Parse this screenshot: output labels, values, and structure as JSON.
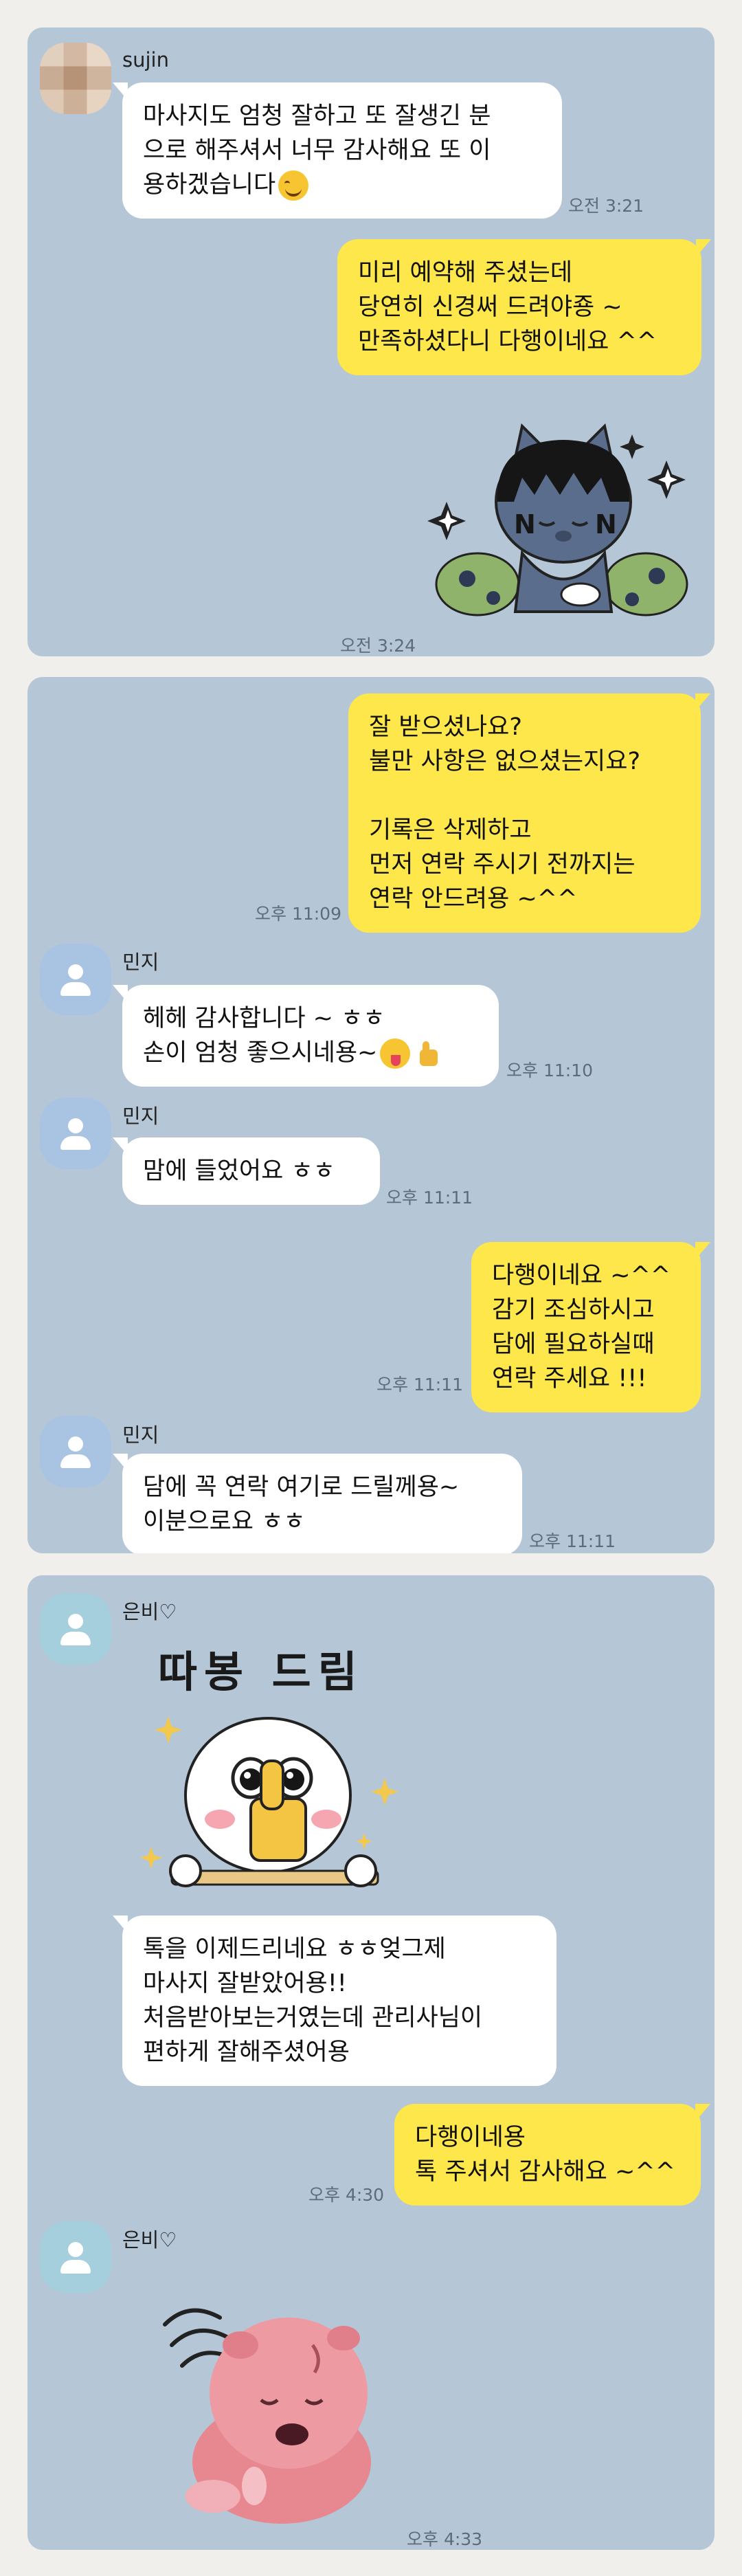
{
  "chat": [
    {
      "panel": "kakao-chat-screenshot-1",
      "sender": "sujin",
      "incoming_message": "마사지도 엄청 잘하고 또 잘생긴 분\n으로 해주셔서 너무 감사해요 또 이\n용하겠습니다",
      "incoming_time": "오전 3:21",
      "reply_message": "미리 예약해 주셨는데\n당연히 신경써 드려야죵 ~\n만족하셨다니 다행이네요 ^^",
      "sticker_time": "오전 3:24"
    },
    {
      "panel": "kakao-chat-screenshot-2",
      "out_message_1": "잘 받으셨나요?\n불만 사항은 없으셨는지요?\n\n기록은 삭제하고\n먼저 연락 주시기 전까지는\n연락 안드려용 ~^^",
      "out_time_1": "오후 11:09",
      "sender": "민지",
      "in_message_1": "헤헤 감사합니다 ~ ㅎㅎ\n손이 엄청 좋으시네용~",
      "in_time_1": "오후 11:10",
      "in_message_2": "맘에 들었어요 ㅎㅎ",
      "in_time_2": "오후 11:11",
      "out_message_2": "다행이네요 ~^^\n감기 조심하시고\n담에 필요하실때\n연락 주세요 !!!",
      "out_time_2": "오후 11:11",
      "in_message_3": "담에 꼭 연락 여기로 드릴께용~\n이분으로요 ㅎㅎ",
      "in_time_3": "오후 11:11"
    },
    {
      "panel": "kakao-chat-screenshot-3",
      "sender": "은비♡",
      "sticker_caption": "따봉 드림",
      "in_message": "톡을 이제드리네요 ㅎㅎ엊그제\n마사지 잘받았어용!!\n처음받아보는거였는데 관리사님이\n편하게 잘해주셨어용",
      "out_message": "다행이네용\n톡 주셔서 감사해요 ~^^",
      "out_time": "오후 4:30",
      "sticker_time": "오후 4:33"
    }
  ],
  "colors": {
    "chat_background": "#b5c6d7",
    "outgoing_bubble": "#fde74a",
    "incoming_bubble": "#ffffff",
    "page_background": "#f1efec"
  }
}
